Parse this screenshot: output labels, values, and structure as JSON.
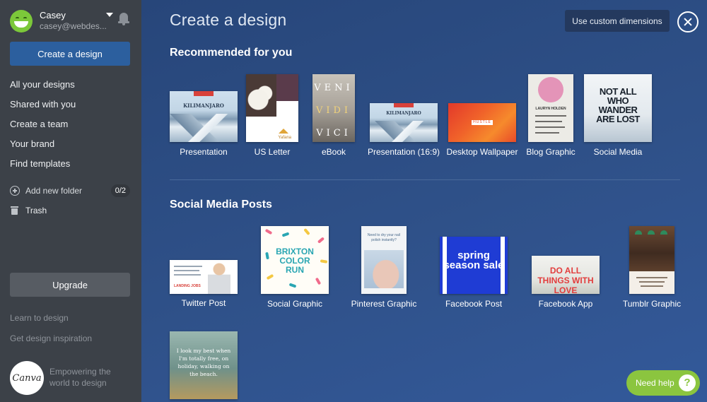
{
  "sidebar": {
    "profile": {
      "name": "Casey",
      "email": "casey@webdes..."
    },
    "create_button": "Create a design",
    "nav": [
      "All your designs",
      "Shared with you",
      "Create a team",
      "Your brand",
      "Find templates"
    ],
    "add_folder_label": "Add new folder",
    "folder_count": "0/2",
    "trash_label": "Trash",
    "upgrade_button": "Upgrade",
    "learn_link": "Learn to design",
    "inspiration_link": "Get design inspiration",
    "logo_text": "Canva",
    "tagline": "Empowering the world to design"
  },
  "main": {
    "title": "Create a design",
    "custom_dimensions_button": "Use custom dimensions",
    "recommended": {
      "heading": "Recommended for you",
      "items": [
        {
          "label": "Presentation",
          "thumb_date": "26.08.2016",
          "thumb_title": "KILIMANJARO"
        },
        {
          "label": "US Letter",
          "thumb_brand": "Yafana"
        },
        {
          "label": "eBook",
          "thumb_words": [
            "VENI",
            "VIDI",
            "VICI"
          ]
        },
        {
          "label": "Presentation (16:9)",
          "thumb_title": "KILIMANJARO"
        },
        {
          "label": "Desktop Wallpaper",
          "thumb_tag": "HUSTLE"
        },
        {
          "label": "Blog Graphic",
          "thumb_name": "LAURYN HOLDEN"
        },
        {
          "label": "Social Media",
          "thumb_text": "NOT ALL WHO WANDER ARE LOST"
        }
      ]
    },
    "social": {
      "heading": "Social Media Posts",
      "items": [
        {
          "label": "Twitter Post",
          "thumb_tag": "LANDING JOBS"
        },
        {
          "label": "Social Graphic",
          "thumb_text": "BRIXTON COLOR RUN"
        },
        {
          "label": "Pinterest Graphic",
          "thumb_text": "Need to dry your nail polish instantly?"
        },
        {
          "label": "Facebook Post",
          "thumb_text": "spring season sale"
        },
        {
          "label": "Facebook App",
          "thumb_text": "DO ALL THINGS WITH LOVE"
        },
        {
          "label": "Tumblr Graphic"
        }
      ],
      "extra_thumb_text": "I look my best when I'm totally free, on holiday, walking on the beach."
    }
  },
  "help_button": "Need help",
  "colors": {
    "sidebar": "#3c4148",
    "accent_blue": "#2c5f9e",
    "main_bg": "#2f5189",
    "help_green": "#8bc53f"
  }
}
